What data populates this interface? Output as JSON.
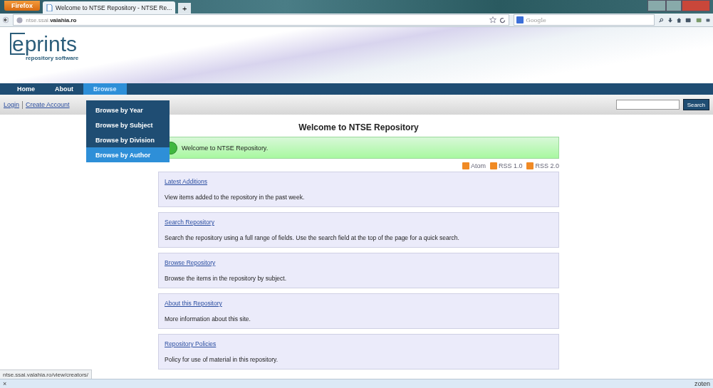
{
  "browser": {
    "menu_button": "Firefox",
    "tabs": [
      {
        "title": "Welcome to NTSE Repository - NTSE Re...",
        "selected": true
      }
    ],
    "new_tab": "+",
    "address": {
      "host_prefix": "ntse.ssai.",
      "host_domain": "valahia.ro"
    },
    "search": {
      "placeholder": "Google"
    }
  },
  "site": {
    "logo": {
      "mark": "e",
      "word": "prints",
      "tagline": "repository software"
    },
    "menu": [
      {
        "label": "Home",
        "selected": false
      },
      {
        "label": "About",
        "selected": false
      },
      {
        "label": "Browse",
        "selected": true
      }
    ],
    "dropdown": [
      {
        "label": "Browse by Year",
        "selected": false
      },
      {
        "label": "Browse by Subject",
        "selected": false
      },
      {
        "label": "Browse by Division",
        "selected": false
      },
      {
        "label": "Browse by Author",
        "selected": true
      }
    ],
    "account_links": [
      "Login",
      "Create Account"
    ],
    "search_button": "Search",
    "title": "Welcome to NTSE Repository",
    "message": "Welcome to NTSE Repository.",
    "feeds": [
      "Atom",
      "RSS 1.0",
      "RSS 2.0"
    ],
    "cards": [
      {
        "title": "Latest Additions",
        "text": "View items added to the repository in the past week."
      },
      {
        "title": "Search Repository",
        "text": "Search the repository using a full range of fields. Use the search field at the top of the page for a quick search."
      },
      {
        "title": "Browse Repository",
        "text": "Browse the items in the repository by subject."
      },
      {
        "title": "About this Repository",
        "text": "More information about this site."
      },
      {
        "title": "Repository Policies",
        "text": "Policy for use of material in this repository."
      }
    ]
  },
  "status_url": "ntse.ssai.valahia.ro/view/creators/",
  "addon_bar": {
    "close": "×",
    "label": "zoten"
  }
}
